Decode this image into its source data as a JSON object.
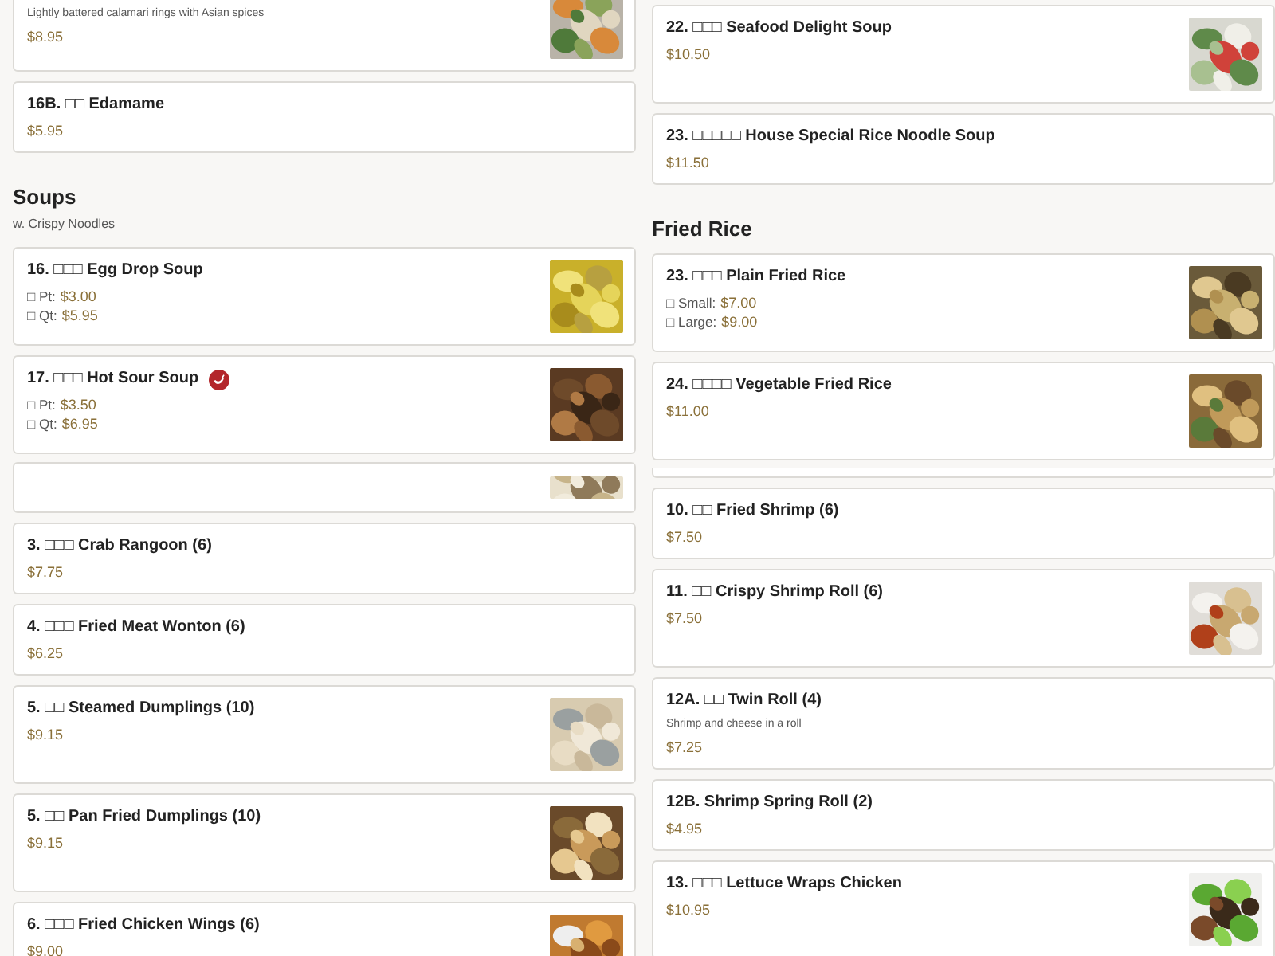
{
  "columns": [
    {
      "items": [
        {
          "kind": "card",
          "description": "Lightly battered calamari rings with Asian spices",
          "price": "$8.95"
        },
        {
          "kind": "card",
          "name": "16B. □□ Edamame",
          "price": "$5.95"
        },
        {
          "kind": "heading",
          "title": "Soups",
          "subtitle": "w. Crispy Noodles"
        },
        {
          "kind": "card",
          "name": "16. □□□ Egg Drop Soup",
          "prices": [
            {
              "label": "□ Pt:",
              "value": "$3.00"
            },
            {
              "label": "□ Qt:",
              "value": "$5.95"
            }
          ]
        },
        {
          "kind": "card",
          "name": "17. □□□ Hot Sour Soup",
          "spicy": true,
          "prices": [
            {
              "label": "□ Pt:",
              "value": "$3.50"
            },
            {
              "label": "□ Qt:",
              "value": "$6.95"
            }
          ]
        },
        {
          "kind": "fragment"
        },
        {
          "kind": "card",
          "name": "3. □□□ Crab Rangoon (6)",
          "price": "$7.75"
        },
        {
          "kind": "card",
          "name": "4. □□□ Fried Meat Wonton (6)",
          "price": "$6.25"
        },
        {
          "kind": "card",
          "name": "5. □□ Steamed Dumplings (10)",
          "price": "$9.15"
        },
        {
          "kind": "card",
          "name": "5. □□ Pan Fried Dumplings (10)",
          "price": "$9.15"
        },
        {
          "kind": "card",
          "name": "6. □□□ Fried Chicken Wings (6)",
          "price": "$9.00"
        }
      ]
    },
    {
      "items": [
        {
          "kind": "card",
          "name": "22. □□□ Seafood Delight Soup",
          "price": "$10.50"
        },
        {
          "kind": "card",
          "name": "23. □□□□□ House Special Rice Noodle Soup",
          "price": "$11.50"
        },
        {
          "kind": "heading",
          "title": "Fried Rice"
        },
        {
          "kind": "card",
          "name": "23. □□□ Plain Fried Rice",
          "prices": [
            {
              "label": "□ Small:",
              "value": "$7.00"
            },
            {
              "label": "□ Large:",
              "value": "$9.00"
            }
          ]
        },
        {
          "kind": "card",
          "name": "24. □□□□ Vegetable Fried Rice",
          "price": "$11.00"
        },
        {
          "kind": "fragment"
        },
        {
          "kind": "card",
          "name": "10. □□ Fried Shrimp (6)",
          "price": "$7.50"
        },
        {
          "kind": "card",
          "name": "11. □□ Crispy Shrimp Roll (6)",
          "price": "$7.50"
        },
        {
          "kind": "card",
          "name": "12A. □□ Twin Roll (4)",
          "description": "Shrimp and cheese in a roll",
          "price": "$7.25"
        },
        {
          "kind": "card",
          "name": "12B. Shrimp Spring Roll (2)",
          "price": "$4.95"
        },
        {
          "kind": "card",
          "name": "13. □□□ Lettuce Wraps Chicken",
          "price": "$10.95"
        }
      ]
    }
  ]
}
